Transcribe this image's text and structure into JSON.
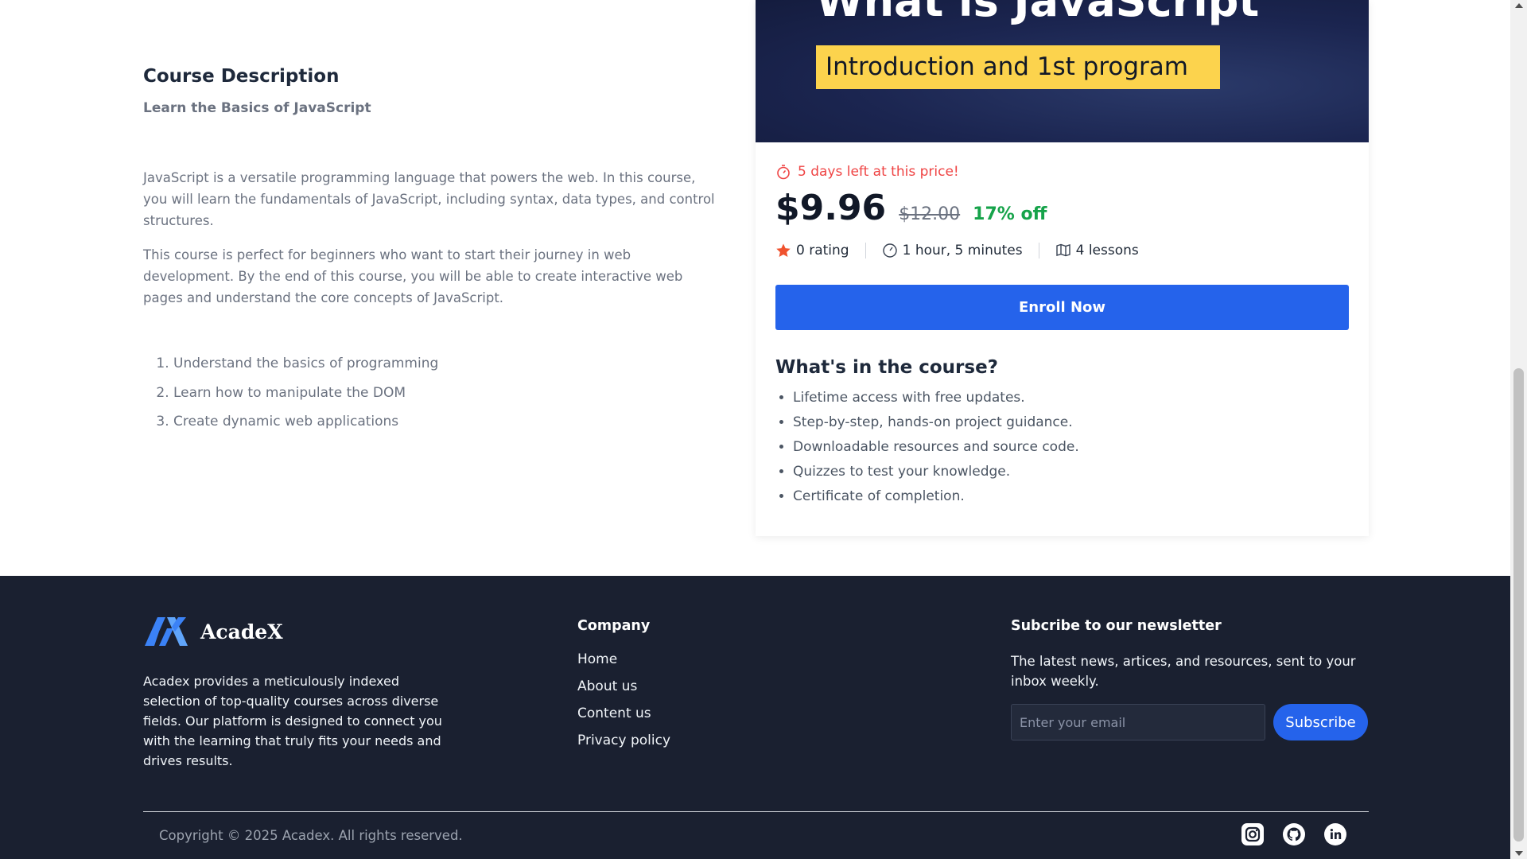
{
  "description": {
    "heading": "Course Description",
    "subtitle": "Learn the Basics of JavaScript",
    "paragraphs": [
      "JavaScript is a versatile programming language that powers the web. In this course, you will learn the fundamentals of JavaScript, including syntax, data types, and control structures.",
      "This course is perfect for beginners who want to start their journey in web development. By the end of this course, you will be able to create interactive web pages and understand the core concepts of JavaScript."
    ],
    "objectives": [
      "Understand the basics of programming",
      "Learn how to manipulate the DOM",
      "Create dynamic web applications"
    ]
  },
  "course_card": {
    "banner_title": "What is JavaScript",
    "banner_tag": "Introduction and 1st program",
    "timer_text": "5 days left at this price!",
    "price": "$9.96",
    "old_price": "$12.00",
    "discount": "17% off",
    "rating": "0 rating",
    "duration": "1 hour, 5 minutes",
    "lessons": "4 lessons",
    "enroll_label": "Enroll Now",
    "whats_heading": "What's in the course?",
    "features": [
      "Lifetime access with free updates.",
      "Step-by-step, hands-on project guidance.",
      "Downloadable resources and source code.",
      "Quizzes to test your knowledge.",
      "Certificate of completion."
    ],
    "icons": [
      "timer-icon",
      "star-icon",
      "clock-icon",
      "book-icon"
    ]
  },
  "footer": {
    "brand": "AcadeX",
    "about": "Acadex provides a meticulously indexed selection of top-quality courses across diverse fields. Our platform is designed to connect you with the learning that truly fits your needs and drives results.",
    "company_heading": "Company",
    "company_links": [
      "Home",
      "About us",
      "Content us",
      "Privacy policy"
    ],
    "newsletter_heading": "Subcribe to our newsletter",
    "newsletter_text": "The latest news, artices, and resources, sent to your inbox weekly.",
    "email_placeholder": "Enter your email",
    "subscribe_label": "Subscribe",
    "copyright": "Copyright © 2025 Acadex. All rights reserved.",
    "socials": [
      "instagram-icon",
      "github-icon",
      "linkedin-icon"
    ]
  },
  "colors": {
    "primary": "#2563eb",
    "footer_bg": "#1a2030",
    "warning": "#ef4444",
    "success": "#16a34a",
    "banner_tag": "#fcd34d"
  }
}
